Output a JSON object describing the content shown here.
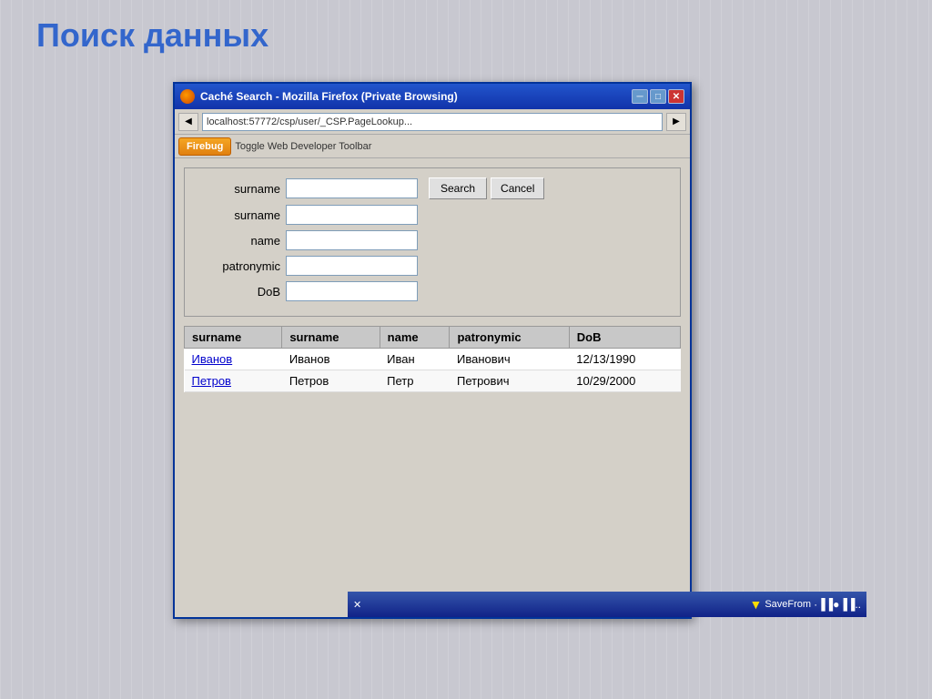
{
  "page": {
    "title": "Поиск данных"
  },
  "browser": {
    "title": "Caché Search - Mozilla Firefox (Private Browsing)",
    "url": "localhost:57772/csp/user/_CSP.PageLookup...",
    "firebug_btn": "Firebug",
    "toolbar_btn": "Toggle Web Developer Toolbar"
  },
  "form": {
    "fields": [
      {
        "label": "surname",
        "id": "f1"
      },
      {
        "label": "surname",
        "id": "f2"
      },
      {
        "label": "name",
        "id": "f3"
      },
      {
        "label": "patronymic",
        "id": "f4"
      },
      {
        "label": "DoB",
        "id": "f5"
      }
    ],
    "search_btn": "Search",
    "cancel_btn": "Cancel"
  },
  "table": {
    "headers": [
      "surname",
      "surname",
      "name",
      "patronymic",
      "DoB"
    ],
    "rows": [
      {
        "col1": "Иванов",
        "col2": "Иванов",
        "col3": "Иван",
        "col4": "Иванович",
        "col5": "12/13/1990",
        "link": true
      },
      {
        "col1": "Петров",
        "col2": "Петров",
        "col3": "Петр",
        "col4": "Петрович",
        "col5": "10/29/2000",
        "link": true
      }
    ]
  },
  "taskbar": {
    "label": "SaveFrom",
    "icon": "▼"
  },
  "window_controls": {
    "minimize": "─",
    "restore": "□",
    "close": "✕"
  }
}
